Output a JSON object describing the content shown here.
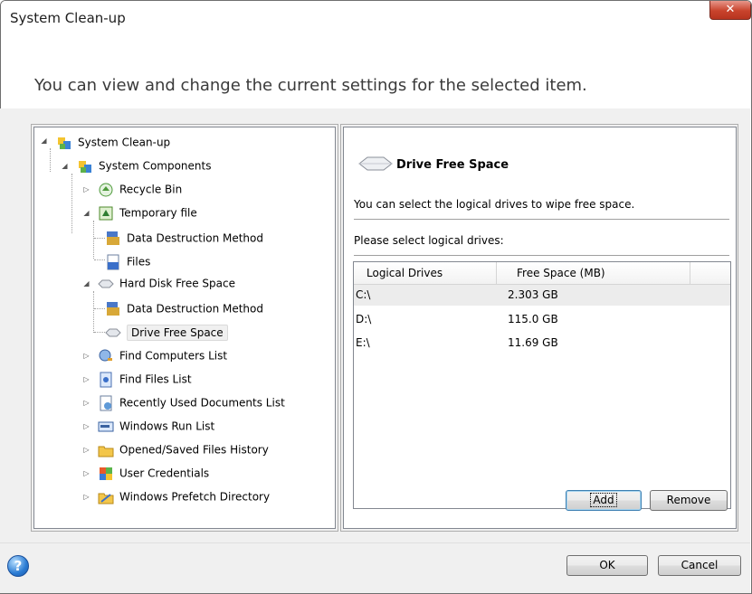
{
  "window": {
    "title": "System Clean-up",
    "close_label": "✕"
  },
  "subtitle": "You can view and change the current settings for the selected item.",
  "tree": {
    "items": [
      {
        "label": "System Clean-up"
      },
      {
        "label": "System Components"
      },
      {
        "label": "Recycle Bin"
      },
      {
        "label": "Temporary file"
      },
      {
        "label": "Data Destruction Method"
      },
      {
        "label": "Files"
      },
      {
        "label": "Hard Disk Free Space"
      },
      {
        "label": "Data Destruction Method"
      },
      {
        "label": "Drive Free Space"
      },
      {
        "label": "Find Computers List"
      },
      {
        "label": "Find Files List"
      },
      {
        "label": "Recently Used Documents List"
      },
      {
        "label": "Windows Run List"
      },
      {
        "label": "Opened/Saved Files History"
      },
      {
        "label": "User Credentials"
      },
      {
        "label": "Windows Prefetch Directory"
      }
    ]
  },
  "detail": {
    "title": "Drive Free Space",
    "description": "You can select the logical drives to wipe free space.",
    "prompt": "Please select logical drives:",
    "columns": [
      "Logical Drives",
      "Free Space (MB)"
    ],
    "rows": [
      {
        "drive": "C:\\",
        "space": "2.303 GB"
      },
      {
        "drive": "D:\\",
        "space": "115.0 GB"
      },
      {
        "drive": "E:\\",
        "space": "11.69 GB"
      }
    ],
    "add_label": "Add",
    "remove_label": "Remove"
  },
  "footer": {
    "ok_label": "OK",
    "cancel_label": "Cancel",
    "help_label": "?"
  }
}
